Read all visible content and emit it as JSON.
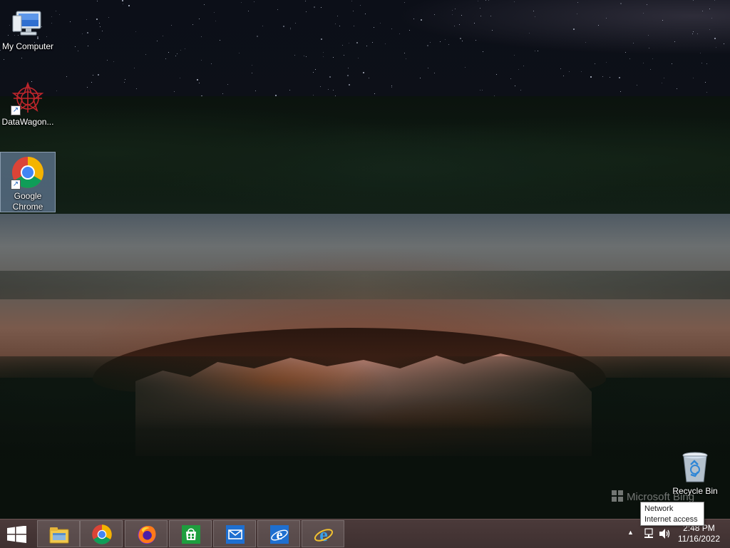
{
  "desktop": {
    "icons": [
      {
        "label": "My Computer",
        "icon": "computer-icon"
      },
      {
        "label": "DataWagon...",
        "icon": "datawagon-icon"
      },
      {
        "label": "Google Chrome",
        "icon": "chrome-icon",
        "selected": true
      },
      {
        "label": "Recycle Bin",
        "icon": "recycle-bin-icon"
      }
    ],
    "watermark": "Microsoft Bing"
  },
  "taskbar": {
    "start": {
      "icon": "windows-start-icon"
    },
    "apps": [
      {
        "name": "File Explorer",
        "icon": "file-explorer-icon"
      },
      {
        "name": "Google Chrome",
        "icon": "chrome-icon"
      },
      {
        "name": "Firefox",
        "icon": "firefox-icon"
      },
      {
        "name": "Store",
        "icon": "store-icon"
      },
      {
        "name": "Mail",
        "icon": "mail-icon"
      },
      {
        "name": "Internet Explorer",
        "icon": "ie-icon"
      },
      {
        "name": "Internet Explorer",
        "icon": "ie-icon"
      }
    ],
    "tray": {
      "chevron": "▲",
      "clock": {
        "time": "2:48 PM",
        "date": "11/16/2022"
      }
    }
  },
  "tooltip": {
    "title": "Network",
    "status": "Internet access"
  },
  "colors": {
    "taskbar": "#4b3a3a",
    "selection": "#96b4e6"
  }
}
